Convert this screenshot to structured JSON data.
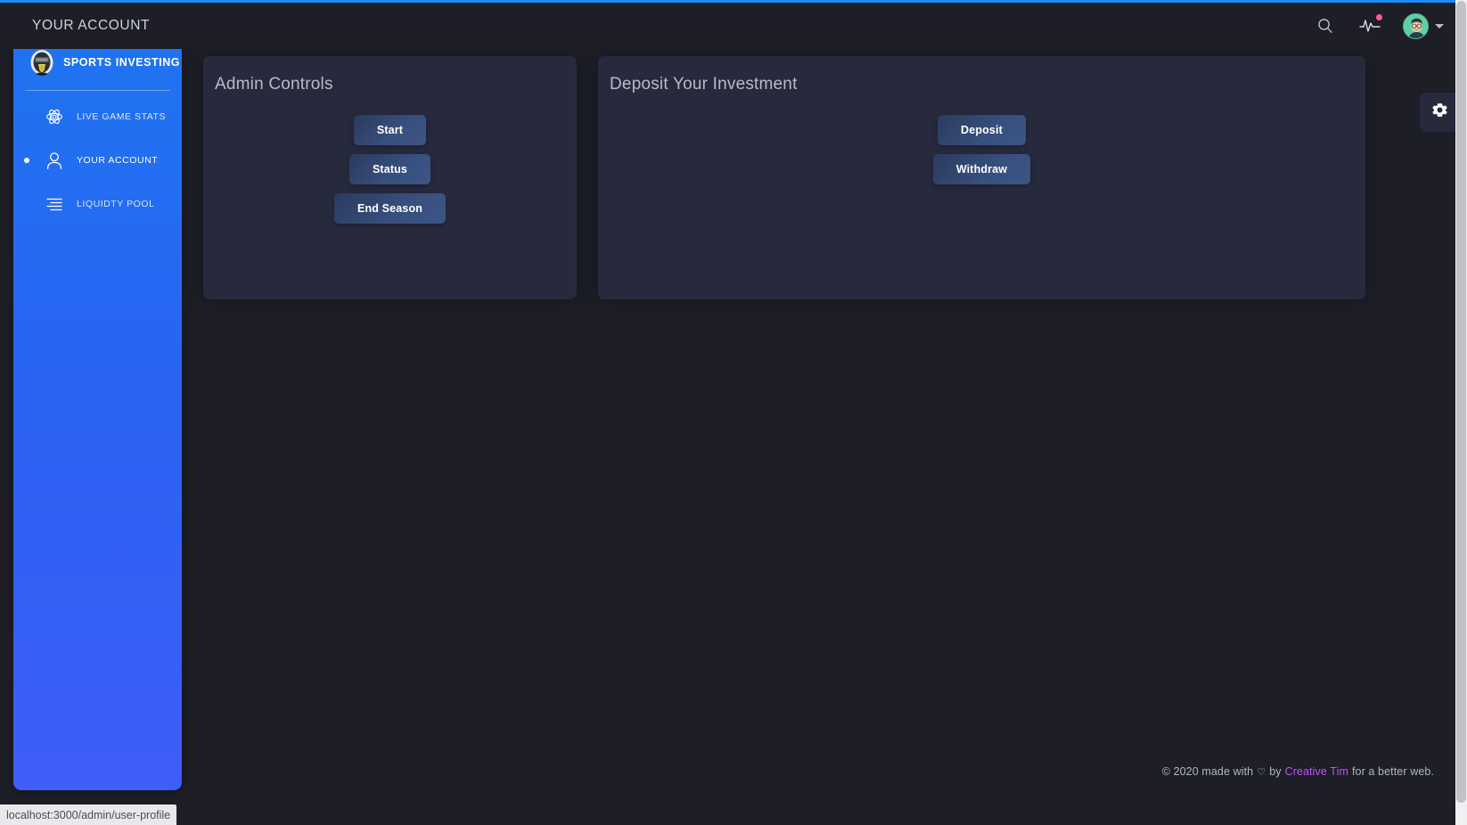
{
  "header": {
    "page_title": "YOUR ACCOUNT",
    "search_icon": "search-icon",
    "activity_icon": "activity-pulse-icon",
    "avatar_icon": "user-avatar",
    "caret_icon": "chevron-down-icon",
    "notification_badge_color": "#fd5d93"
  },
  "sidebar": {
    "brand_label": "SPORTS INVESTING",
    "brand_logo_icon": "helmet-shield-logo",
    "accent_color": "#2a62f2",
    "items": [
      {
        "label": "LIVE GAME STATS",
        "icon": "atom-icon",
        "active": false
      },
      {
        "label": "YOUR ACCOUNT",
        "icon": "user-icon",
        "active": true
      },
      {
        "label": "LIQUIDTY POOL",
        "icon": "align-lines-icon",
        "active": false
      }
    ]
  },
  "cards": {
    "admin": {
      "title": "Admin Controls",
      "buttons": [
        {
          "label": "Start"
        },
        {
          "label": "Status"
        },
        {
          "label": "End Season"
        }
      ]
    },
    "deposit": {
      "title": "Deposit Your Investment",
      "buttons": [
        {
          "label": "Deposit"
        },
        {
          "label": "Withdraw"
        }
      ]
    }
  },
  "settings_tab": {
    "icon": "gear-icon"
  },
  "footer": {
    "copyright": "© 2020 made with",
    "heart": "♡",
    "by": "by",
    "brand": "Creative Tim",
    "suffix": "for a better web."
  },
  "status_bar": {
    "url": "localhost:3000/admin/user-profile"
  },
  "theme": {
    "background": "#1e1e27",
    "card_background": "#27293d",
    "sidebar_blue": "#2a62f2",
    "button_gradient_start": "#2b3a5e",
    "button_gradient_end": "#3c5586",
    "brand_purple": "#ba54f5",
    "loading_bar": "#1d8cf8"
  }
}
